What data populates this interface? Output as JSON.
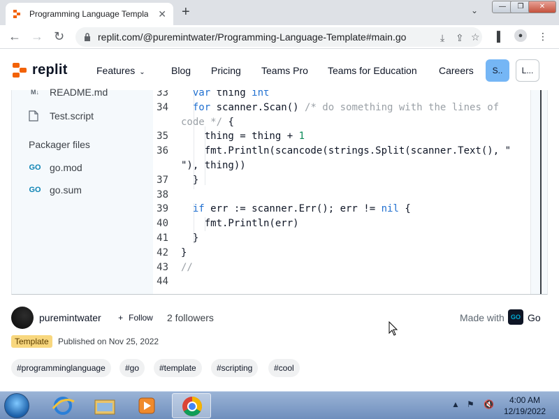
{
  "browser": {
    "tab_title": "Programming Language Templat",
    "tab_close": "✕",
    "new_tab": "+",
    "url": "replit.com/@puremintwater/Programming-Language-Template#main.go"
  },
  "site": {
    "logo_text": "replit",
    "nav": {
      "features": "Features",
      "blog": "Blog",
      "pricing": "Pricing",
      "teams_pro": "Teams Pro",
      "teams_education": "Teams for Education",
      "careers": "Careers"
    },
    "signup_label": "S..",
    "login_label": "L..."
  },
  "sidebar": {
    "files": [
      {
        "icon": "M↓",
        "name": "README.md"
      },
      {
        "icon": "📄",
        "name": "Test.script"
      }
    ],
    "packager_heading": "Packager files",
    "packager_files": [
      {
        "icon": "GO",
        "name": "go.mod"
      },
      {
        "icon": "GO",
        "name": "go.sum"
      }
    ]
  },
  "code": {
    "lines": [
      {
        "n": "33",
        "text": "  var thing int"
      },
      {
        "n": "34",
        "text": "  for scanner.Scan() /* do something with the lines of"
      },
      {
        "n": "",
        "text": "code */ {"
      },
      {
        "n": "35",
        "text": "    thing = thing + 1"
      },
      {
        "n": "36",
        "text": "    fmt.Println(scancode(strings.Split(scanner.Text(), \""
      },
      {
        "n": "",
        "text": "\"), thing))"
      },
      {
        "n": "37",
        "text": "  }"
      },
      {
        "n": "38",
        "text": ""
      },
      {
        "n": "39",
        "text": "  if err := scanner.Err(); err != nil {"
      },
      {
        "n": "40",
        "text": "    fmt.Println(err)"
      },
      {
        "n": "41",
        "text": "  }"
      },
      {
        "n": "42",
        "text": "}"
      },
      {
        "n": "43",
        "text": "//"
      },
      {
        "n": "44",
        "text": ""
      }
    ]
  },
  "author": {
    "name": "puremintwater",
    "follow_label": "Follow",
    "followers": "2 followers",
    "made_with": "Made with",
    "language_badge": "GO",
    "language": "Go"
  },
  "meta": {
    "badge": "Template",
    "published": "Published on Nov 25, 2022"
  },
  "tags": [
    "#programminglanguage",
    "#go",
    "#template",
    "#scripting",
    "#cool"
  ],
  "taskbar": {
    "time": "4:00 AM",
    "date": "12/19/2022"
  },
  "colors": {
    "accent": "#f26207",
    "signup": "#75b6f5",
    "template_badge": "#f8d77e"
  }
}
